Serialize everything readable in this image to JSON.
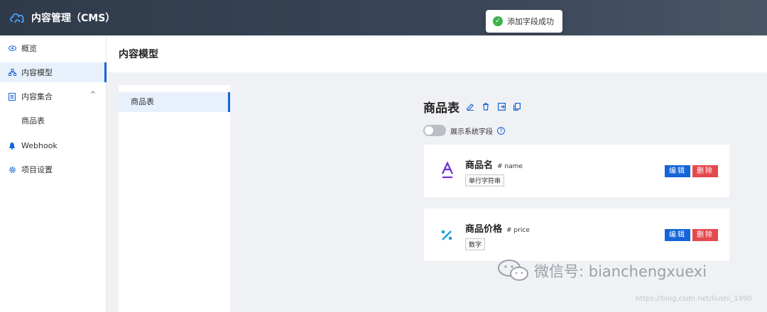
{
  "app": {
    "title": "内容管理（CMS）"
  },
  "toast": {
    "text": "添加字段成功"
  },
  "sidebar": {
    "items": [
      {
        "label": "概览",
        "icon": "eye-icon"
      },
      {
        "label": "内容模型",
        "icon": "model-tree-icon",
        "active": true
      },
      {
        "label": "内容集合",
        "icon": "collection-icon",
        "expanded": true
      },
      {
        "label": "商品表",
        "sub": true
      },
      {
        "label": "Webhook",
        "icon": "webhook-icon"
      },
      {
        "label": "项目设置",
        "icon": "gear-icon"
      }
    ]
  },
  "page": {
    "title": "内容模型"
  },
  "models": [
    {
      "label": "商品表",
      "active": true
    }
  ],
  "detail": {
    "name": "商品表",
    "show_system_fields_label": "展示系统字段",
    "fields": [
      {
        "name": "商品名",
        "key": "# name",
        "type": "单行字符串",
        "icon": "text-a-icon",
        "edit_label": "编辑",
        "delete_label": "删除"
      },
      {
        "name": "商品价格",
        "key": "# price",
        "type": "数字",
        "icon": "percent-icon",
        "edit_label": "编辑",
        "delete_label": "删除"
      }
    ]
  },
  "watermark": {
    "text": "微信号: bianchengxuexi",
    "url": "https://blog.csdn.net/liushi_1990"
  },
  "colors": {
    "accent": "#1565d8",
    "danger": "#e5484d",
    "success": "#3bb34a",
    "header": "#2f3a4a"
  }
}
